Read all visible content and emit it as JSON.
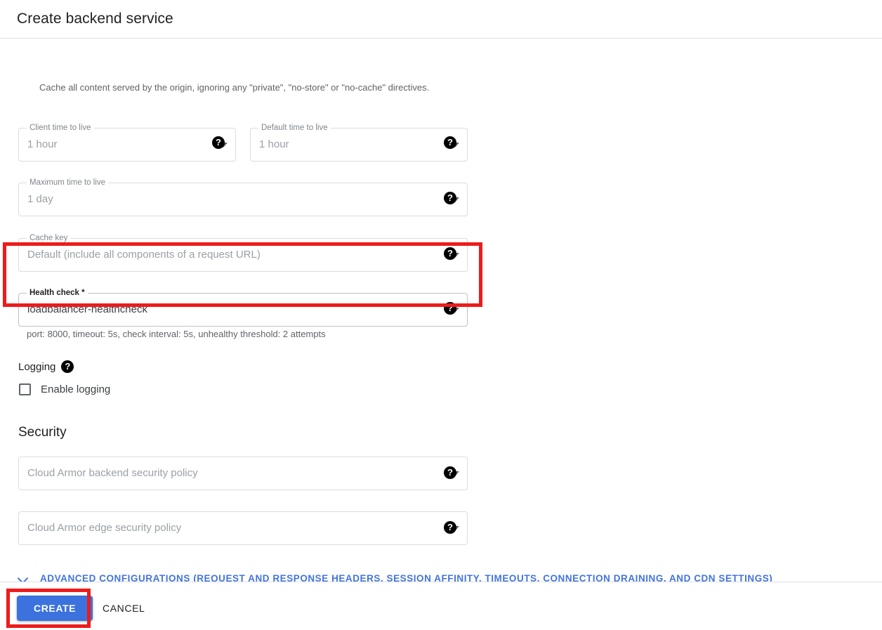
{
  "header": {
    "title": "Create backend service"
  },
  "cache": {
    "note": "Cache all content served by the origin, ignoring any \"private\", \"no-store\" or \"no-cache\" directives.",
    "client_ttl": {
      "label": "Client time to live",
      "value": "1 hour"
    },
    "default_ttl": {
      "label": "Default time to live",
      "value": "1 hour"
    },
    "maximum_ttl": {
      "label": "Maximum time to live",
      "value": "1 day"
    },
    "cache_key": {
      "label": "Cache key",
      "value": "Default (include all components of a request URL)"
    }
  },
  "health_check": {
    "label": "Health check *",
    "value": "loadbalancer-healthcheck",
    "hint": "port: 8000, timeout: 5s, check interval: 5s, unhealthy threshold: 2 attempts"
  },
  "logging": {
    "heading": "Logging",
    "checkbox_label": "Enable logging",
    "checked": false
  },
  "security": {
    "heading": "Security",
    "backend_policy": {
      "value": "Cloud Armor backend security policy"
    },
    "edge_policy": {
      "value": "Cloud Armor edge security policy"
    }
  },
  "advanced": {
    "label": "ADVANCED CONFIGURATIONS (REQUEST AND RESPONSE HEADERS, SESSION AFFINITY, TIMEOUTS, CONNECTION DRAINING, AND CDN SETTINGS)"
  },
  "footer": {
    "create_label": "CREATE",
    "cancel_label": "CANCEL"
  },
  "icons": {
    "help": "?"
  },
  "colors": {
    "primary_button": "#3b72dd",
    "link": "#4274de",
    "annotation": "#ee1b1b"
  }
}
